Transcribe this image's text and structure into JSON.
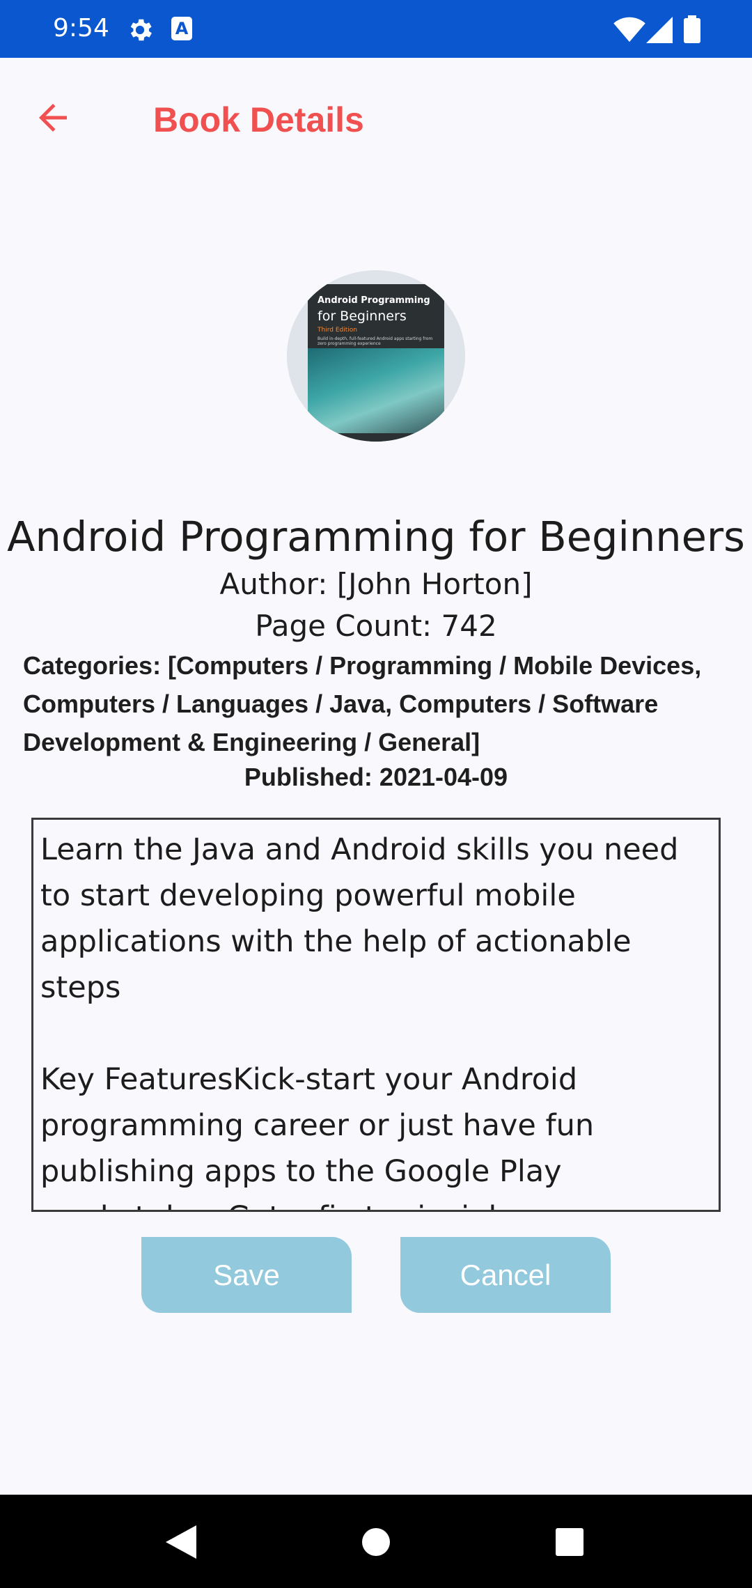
{
  "status_bar": {
    "time": "9:54",
    "icons": [
      "gear-icon",
      "a-notification-icon",
      "wifi-icon",
      "signal-icon",
      "battery-icon"
    ]
  },
  "app_bar": {
    "title": "Book Details",
    "back_icon": "arrow-back-icon",
    "accent_color": "#f05050"
  },
  "book": {
    "cover": {
      "line1": "Android Programming",
      "line2": "for Beginners",
      "line3": "Third Edition",
      "line4": "Build in-depth, full-featured Android apps starting from zero programming experience"
    },
    "title": "Android Programming for Beginners",
    "author": "Author: [John Horton]",
    "page_count": "Page Count: 742",
    "categories": "Categories: [Computers / Programming / Mobile Devices, Computers / Languages / Java, Computers / Software Development & Engineering / General]",
    "published": "Published: 2021-04-09",
    "description": "Learn the Java and Android skills you need to start developing powerful mobile applications with the help of actionable steps\n\nKey FeaturesKick-start your Android programming career or just have fun publishing apps to the Google Play marketplaceGet a first principles introduction to using Java and Android and prepare to start building your own apps"
  },
  "actions": {
    "save_label": "Save",
    "cancel_label": "Cancel",
    "button_color": "#93c9dc"
  },
  "nav_bar": {
    "icons": [
      "nav-back-icon",
      "nav-home-icon",
      "nav-recents-icon"
    ]
  }
}
